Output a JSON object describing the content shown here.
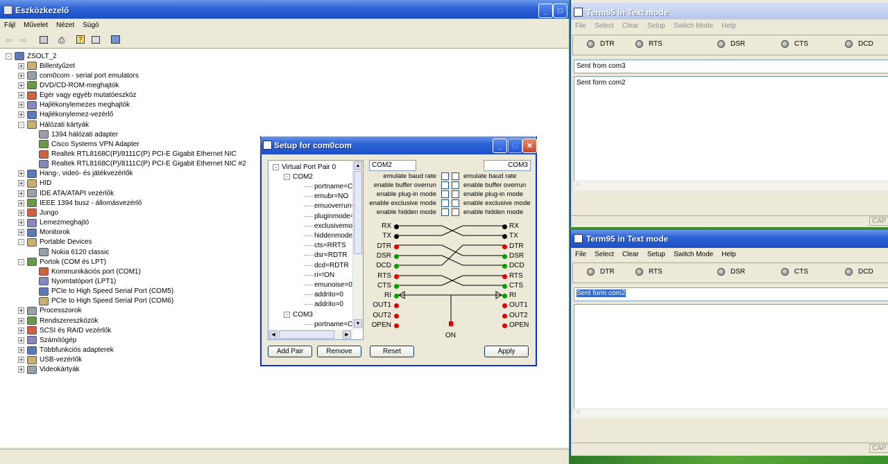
{
  "devmgr": {
    "title": "Eszközkezelő",
    "menu": [
      "Fájl",
      "Művelet",
      "Nézet",
      "Súgó"
    ],
    "tree": [
      {
        "label": "ZSOLT_2",
        "level": 0,
        "exp": "-"
      },
      {
        "label": "Billentyűzet",
        "level": 1,
        "exp": "+"
      },
      {
        "label": "com0com - serial port emulators",
        "level": 1,
        "exp": "+"
      },
      {
        "label": "DVD/CD-ROM-meghajtók",
        "level": 1,
        "exp": "+"
      },
      {
        "label": "Egér vagy egyéb mutatóeszköz",
        "level": 1,
        "exp": "+"
      },
      {
        "label": "Hajlékonylemezes meghajtók",
        "level": 1,
        "exp": "+"
      },
      {
        "label": "Hajlékonylemez-vezérlő",
        "level": 1,
        "exp": "+"
      },
      {
        "label": "Hálózati kártyák",
        "level": 1,
        "exp": "-"
      },
      {
        "label": "1394 hálózati adapter",
        "level": 2,
        "exp": ""
      },
      {
        "label": "Cisco Systems VPN Adapter",
        "level": 2,
        "exp": ""
      },
      {
        "label": "Realtek RTL8168C(P)/8111C(P) PCI-E Gigabit Ethernet NIC",
        "level": 2,
        "exp": ""
      },
      {
        "label": "Realtek RTL8168C(P)/8111C(P) PCI-E Gigabit Ethernet NIC #2",
        "level": 2,
        "exp": ""
      },
      {
        "label": "Hang-, videó- és játékvezérlők",
        "level": 1,
        "exp": "+"
      },
      {
        "label": "HID",
        "level": 1,
        "exp": "+"
      },
      {
        "label": "IDE ATA/ATAPI vezérlők",
        "level": 1,
        "exp": "+"
      },
      {
        "label": "IEEE 1394 busz - állomásvezérlő",
        "level": 1,
        "exp": "+"
      },
      {
        "label": "Jungo",
        "level": 1,
        "exp": "+"
      },
      {
        "label": "Lemezmeghajtó",
        "level": 1,
        "exp": "+"
      },
      {
        "label": "Monitorok",
        "level": 1,
        "exp": "+"
      },
      {
        "label": "Portable Devices",
        "level": 1,
        "exp": "-"
      },
      {
        "label": "Nokia 6120 classic",
        "level": 2,
        "exp": ""
      },
      {
        "label": "Portok (COM és LPT)",
        "level": 1,
        "exp": "-"
      },
      {
        "label": "Kommunikációs port (COM1)",
        "level": 2,
        "exp": ""
      },
      {
        "label": "Nyomtatóport (LPT1)",
        "level": 2,
        "exp": ""
      },
      {
        "label": "PCIe to High Speed Serial Port (COM5)",
        "level": 2,
        "exp": ""
      },
      {
        "label": "PCIe to High Speed Serial Port (COM6)",
        "level": 2,
        "exp": ""
      },
      {
        "label": "Processzorok",
        "level": 1,
        "exp": "+"
      },
      {
        "label": "Rendszereszközök",
        "level": 1,
        "exp": "+"
      },
      {
        "label": "SCSI és RAID vezérlők",
        "level": 1,
        "exp": "+"
      },
      {
        "label": "Számítógép",
        "level": 1,
        "exp": "+"
      },
      {
        "label": "Többfunkciós adapterek",
        "level": 1,
        "exp": "+"
      },
      {
        "label": "USB-vezérlők",
        "level": 1,
        "exp": "+"
      },
      {
        "label": "Videokártyák",
        "level": 1,
        "exp": "+"
      }
    ]
  },
  "term_top": {
    "title": "Term95 in Text mode",
    "menu": [
      "File",
      "Select",
      "Clear",
      "Setup",
      "Switch Mode",
      "Help"
    ],
    "leds": [
      "DTR",
      "RTS",
      "DSR",
      "CTS",
      "DCD"
    ],
    "send_text": "Sent from com3",
    "receive_text": "Sent form com2",
    "status": "CAP"
  },
  "term_bottom": {
    "title": "Term95 in Text mode",
    "menu": [
      "File",
      "Select",
      "Clear",
      "Setup",
      "Switch Mode",
      "Help"
    ],
    "leds": [
      "DTR",
      "RTS",
      "DSR",
      "CTS",
      "DCD"
    ],
    "send_text": "Sent form com2",
    "status": "CAP"
  },
  "setup": {
    "title": "Setup for com0com",
    "tree": [
      {
        "label": "Virtual Port Pair 0",
        "indent": 0,
        "exp": "-"
      },
      {
        "label": "COM2",
        "indent": 1,
        "exp": "-"
      },
      {
        "label": "portname=COM",
        "indent": 2,
        "exp": ""
      },
      {
        "label": "emubr=NO",
        "indent": 2,
        "exp": ""
      },
      {
        "label": "emuoverrun=NO",
        "indent": 2,
        "exp": ""
      },
      {
        "label": "pluginmode=NO",
        "indent": 2,
        "exp": ""
      },
      {
        "label": "exclusivemode=",
        "indent": 2,
        "exp": ""
      },
      {
        "label": "hiddenmode=NO",
        "indent": 2,
        "exp": ""
      },
      {
        "label": "cts=RRTS",
        "indent": 2,
        "exp": ""
      },
      {
        "label": "dsr=RDTR",
        "indent": 2,
        "exp": ""
      },
      {
        "label": "dcd=RDTR",
        "indent": 2,
        "exp": ""
      },
      {
        "label": "ri=!ON",
        "indent": 2,
        "exp": ""
      },
      {
        "label": "emunoise=0",
        "indent": 2,
        "exp": ""
      },
      {
        "label": "addrito=0",
        "indent": 2,
        "exp": ""
      },
      {
        "label": "addrito=0",
        "indent": 2,
        "exp": ""
      },
      {
        "label": "COM3",
        "indent": 1,
        "exp": "-"
      },
      {
        "label": "portname=COM",
        "indent": 2,
        "exp": ""
      }
    ],
    "left_port": "COM2",
    "right_port": "COM3",
    "options": [
      "emulate baud rate",
      "enable buffer overrun",
      "enable plug-in mode",
      "enable exclusive mode",
      "enable hidden mode"
    ],
    "signals": [
      {
        "name": "RX",
        "left": "black",
        "right": "black"
      },
      {
        "name": "TX",
        "left": "black",
        "right": "black"
      },
      {
        "name": "DTR",
        "left": "red",
        "right": "red"
      },
      {
        "name": "DSR",
        "left": "green",
        "right": "green"
      },
      {
        "name": "DCD",
        "left": "green",
        "right": "green"
      },
      {
        "name": "RTS",
        "left": "red",
        "right": "red"
      },
      {
        "name": "CTS",
        "left": "green",
        "right": "green"
      },
      {
        "name": "RI",
        "left": "green",
        "right": "green"
      },
      {
        "name": "OUT1",
        "left": "red",
        "right": "red"
      },
      {
        "name": "OUT2",
        "left": "red",
        "right": "red"
      },
      {
        "name": "OPEN",
        "left": "red",
        "right": "red"
      }
    ],
    "on_label": "ON",
    "buttons": {
      "add": "Add Pair",
      "remove": "Remove",
      "reset": "Reset",
      "apply": "Apply"
    }
  }
}
